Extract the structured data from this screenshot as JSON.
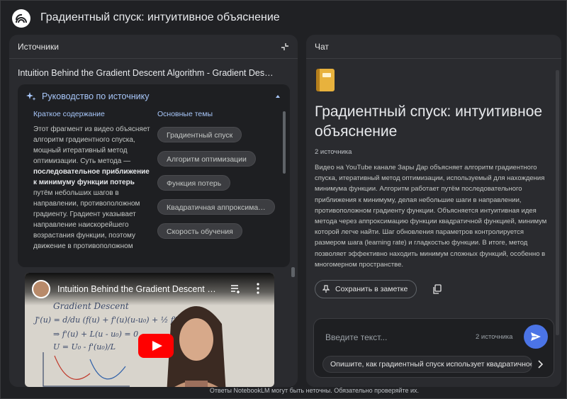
{
  "header": {
    "title": "Градиентный спуск: интуитивное объяснение"
  },
  "sources_panel": {
    "title": "Источники",
    "source_title": "Intuition Behind the Gradient Descent Algorithm - Gradient Des…",
    "guide": {
      "title": "Руководство по источнику",
      "summary_label": "Краткое содержание",
      "topics_label": "Основные темы",
      "summary_before": "Этот фрагмент из видео объясняет алгоритм градиентного спуска, мощный итеративный метод оптимизации. Суть метода — ",
      "summary_bold": "последовательное приближение к минимуму функции потерь",
      "summary_after": " путём небольших шагов в направлении, противоположном градиенту. Градиент указывает направление наискорейшего возрастания функции, поэтому движение в противоположном",
      "topics": [
        "Градиентный спуск",
        "Алгоритм оптимизации",
        "Функция потерь",
        "Квадратичная аппроксима…",
        "Скорость обучения"
      ]
    },
    "video": {
      "title": "Intuition Behind the Gradient Descent …",
      "board_lines": [
        "Gradient Descent",
        "J'(u) = d/du (f(u) + f'(u)(u-u₀) + ½ f\"(u)…",
        "⇒ f'(u) + L(u - u₀) = 0",
        "U = U₀ - f'(u₀)/L"
      ]
    }
  },
  "chat_panel": {
    "title": "Чат",
    "notebook_title": "Градиентный спуск: интуитивное объяснение",
    "source_count": "2 источника",
    "summary": "Видео на YouTube канале Зары Дар объясняет алгоритм градиентного спуска, итеративный метод оптимизации, используемый для нахождения минимума функции. Алгоритм работает путём последовательного приближения к минимуму, делая небольшие шаги в направлении, противоположном градиенту функции. Объясняется интуитивная идея метода через аппроксимацию функции квадратичной функцией, минимум которой легче найти. Шаг обновления параметров контролируется размером шага (learning rate) и гладкостью функции. В итоге, метод позволяет эффективно находить минимум сложных функций, особенно в многомерном пространстве.",
    "save_button": "Сохранить в заметке",
    "input": {
      "placeholder": "Введите текст...",
      "source_count": "2 источника",
      "suggestion": "Опишите, как градиентный спуск использует квадратичное"
    }
  },
  "footer": {
    "disclaimer": "Ответы NotebookLM могут быть неточны. Обязательно проверяйте их."
  },
  "colors": {
    "accent": "#a8c7fa",
    "send_button": "#4b74e6",
    "background": "#202124",
    "panel": "#2a2b2f",
    "youtube_red": "#ff0000"
  },
  "icons": {
    "logo": "notebooklm-logo-icon",
    "collapse": "collapse-panel-icon",
    "sparkle": "sparkle-icon",
    "chevron": "chevron-up-icon",
    "pin": "pin-icon",
    "copy": "copy-icon",
    "send": "send-icon",
    "next": "chevron-right-icon",
    "queue": "playlist-add-icon",
    "more": "more-vert-icon",
    "notebook": "notebook-emoji-icon"
  }
}
